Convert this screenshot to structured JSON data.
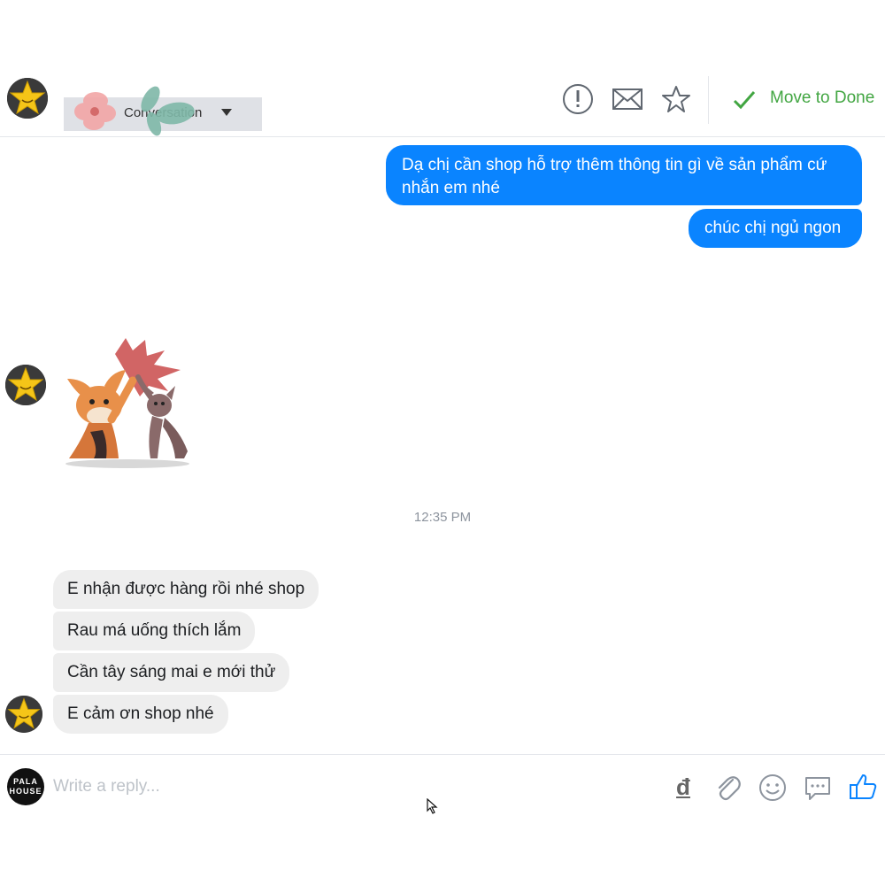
{
  "header": {
    "conversation_label": "Conversation",
    "move_to_done_label": "Move to Done",
    "icons": [
      "spam-icon",
      "mark-unread-icon",
      "star-icon",
      "checkmark-icon"
    ],
    "accent_color": "#42a642"
  },
  "messages": {
    "outgoing": [
      "Dạ chị cần shop hỗ trợ thêm thông tin gì về sản phẩm cứ nhắn em nhé",
      "chúc chị ngủ ngon"
    ],
    "timestamp": "12:35 PM",
    "incoming": [
      "E nhận được hàng rồi nhé shop",
      "Rau má uống thích lắm",
      "Cần tây sáng mai e mới thử",
      "E cảm ơn shop nhé"
    ],
    "outgoing_color": "#0a84ff"
  },
  "composer": {
    "page_avatar_text": "PALA HOUSE",
    "placeholder": "Write a reply...",
    "currency_symbol": "đ",
    "icons": [
      "currency-icon",
      "attachment-icon",
      "emoji-icon",
      "saved-replies-icon",
      "like-icon"
    ]
  }
}
